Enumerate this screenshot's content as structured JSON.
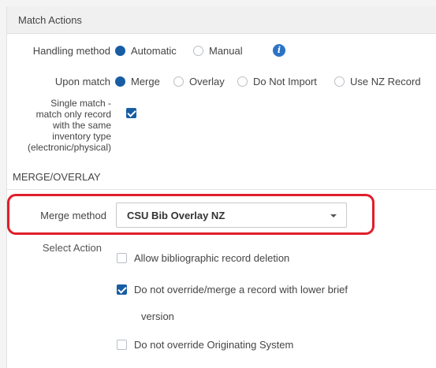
{
  "section": {
    "title": "Match Actions"
  },
  "handling": {
    "label": "Handling method",
    "options": [
      {
        "label": "Automatic",
        "selected": true
      },
      {
        "label": "Manual",
        "selected": false
      }
    ],
    "info_icon": "info-icon"
  },
  "upon_match": {
    "label": "Upon match",
    "options": [
      {
        "label": "Merge",
        "selected": true
      },
      {
        "label": "Overlay",
        "selected": false
      },
      {
        "label": "Do Not Import",
        "selected": false
      },
      {
        "label": "Use NZ Record",
        "selected": false
      }
    ]
  },
  "single_match": {
    "label_lines": [
      "Single match -",
      "match only record",
      "with the same",
      "inventory type",
      "(electronic/physical)"
    ],
    "checked": true
  },
  "merge_overlay": {
    "heading": "MERGE/OVERLAY"
  },
  "merge_method": {
    "label": "Merge method",
    "value": "CSU Bib Overlay NZ"
  },
  "select_action": {
    "label": "Select Action",
    "options": [
      {
        "label": "Allow bibliographic record deletion",
        "checked": false
      },
      {
        "label": "Do not override/merge a record with lower brief",
        "checked": true
      },
      {
        "label": "version",
        "checked": null
      },
      {
        "label": "Do not override Originating System",
        "checked": false
      }
    ]
  },
  "colors": {
    "accent": "#185da3",
    "highlight": "#e01e2b",
    "info": "#2c73c5"
  }
}
